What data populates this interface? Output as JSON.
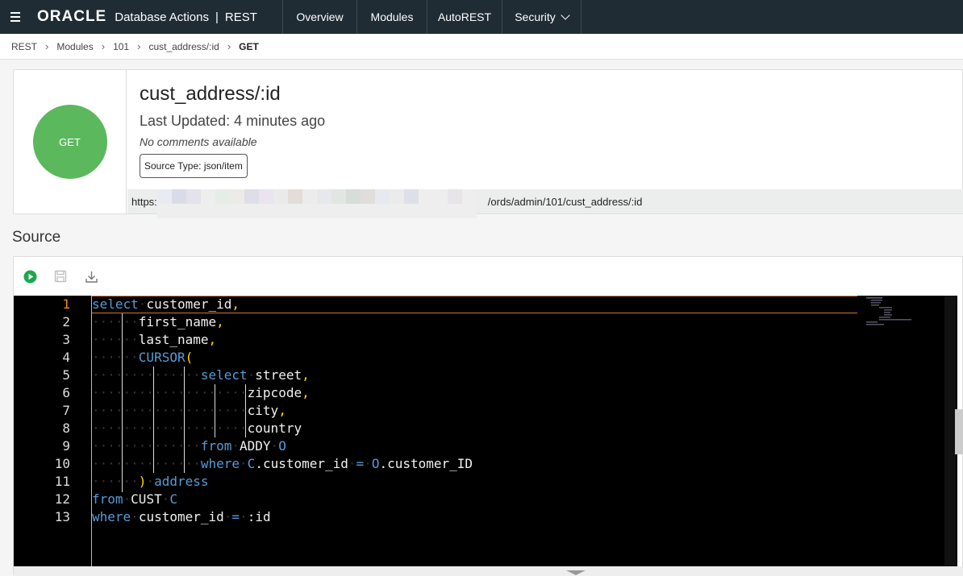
{
  "topbar": {
    "logo": "ORACLE",
    "product": "Database Actions",
    "separator": "|",
    "area": "REST",
    "nav": [
      {
        "label": "Overview"
      },
      {
        "label": "Modules"
      },
      {
        "label": "AutoREST"
      },
      {
        "label": "Security"
      }
    ]
  },
  "breadcrumb": [
    "REST",
    "Modules",
    "101",
    "cust_address/:id",
    "GET"
  ],
  "card": {
    "method": "GET",
    "method_color": "#5cb85c",
    "title": "cust_address/:id",
    "updated": "Last Updated: 4 minutes ago",
    "comments": "No comments available",
    "source_type": "Source Type: json/item",
    "url_prefix": "https:",
    "url_suffix": "/ords/admin/101/cust_address/:id"
  },
  "source": {
    "heading": "Source",
    "toolbar": {
      "run_icon": "play-circle-icon",
      "save_icon": "save-icon",
      "download_icon": "download-icon"
    },
    "active_line": 1,
    "lines": [
      {
        "num": "1",
        "tokens": [
          [
            "kw",
            "select"
          ],
          [
            "dots",
            "·"
          ],
          [
            "id",
            "customer_id"
          ],
          [
            "punc",
            ","
          ]
        ]
      },
      {
        "num": "2",
        "tokens": [
          [
            "dots",
            "······"
          ],
          [
            "id",
            "first_name"
          ],
          [
            "punc",
            ","
          ]
        ]
      },
      {
        "num": "3",
        "tokens": [
          [
            "dots",
            "······"
          ],
          [
            "id",
            "last_name"
          ],
          [
            "punc",
            ","
          ]
        ]
      },
      {
        "num": "4",
        "tokens": [
          [
            "dots",
            "······"
          ],
          [
            "kw",
            "CURSOR"
          ],
          [
            "punc",
            "("
          ]
        ]
      },
      {
        "num": "5",
        "tokens": [
          [
            "dots",
            "··············"
          ],
          [
            "kw",
            "select"
          ],
          [
            "dots",
            "·"
          ],
          [
            "id",
            "street"
          ],
          [
            "punc",
            ","
          ]
        ]
      },
      {
        "num": "6",
        "tokens": [
          [
            "dots",
            "····················"
          ],
          [
            "id",
            "zipcode"
          ],
          [
            "punc",
            ","
          ]
        ]
      },
      {
        "num": "7",
        "tokens": [
          [
            "dots",
            "····················"
          ],
          [
            "id",
            "city"
          ],
          [
            "punc",
            ","
          ]
        ]
      },
      {
        "num": "8",
        "tokens": [
          [
            "dots",
            "····················"
          ],
          [
            "id",
            "country"
          ]
        ]
      },
      {
        "num": "9",
        "tokens": [
          [
            "dots",
            "··············"
          ],
          [
            "kw",
            "from"
          ],
          [
            "dots",
            "·"
          ],
          [
            "id",
            "ADDY"
          ],
          [
            "dots",
            "·"
          ],
          [
            "kw",
            "O"
          ]
        ]
      },
      {
        "num": "10",
        "tokens": [
          [
            "dots",
            "··············"
          ],
          [
            "kw",
            "where"
          ],
          [
            "dots",
            "·"
          ],
          [
            "kw",
            "C"
          ],
          [
            "id",
            ".customer_id"
          ],
          [
            "dots",
            "·"
          ],
          [
            "kw",
            "="
          ],
          [
            "dots",
            "·"
          ],
          [
            "kw",
            "O"
          ],
          [
            "id",
            ".customer_ID"
          ]
        ]
      },
      {
        "num": "11",
        "tokens": [
          [
            "dots",
            "······"
          ],
          [
            "punc",
            ")"
          ],
          [
            "dots",
            "·"
          ],
          [
            "kw",
            "address"
          ]
        ]
      },
      {
        "num": "12",
        "tokens": [
          [
            "kw",
            "from"
          ],
          [
            "dots",
            "·"
          ],
          [
            "id",
            "CUST"
          ],
          [
            "dots",
            "·"
          ],
          [
            "kw",
            "C"
          ]
        ]
      },
      {
        "num": "13",
        "tokens": [
          [
            "kw",
            "where"
          ],
          [
            "dots",
            "·"
          ],
          [
            "id",
            "customer_id"
          ],
          [
            "dots",
            "·"
          ],
          [
            "kw",
            "="
          ],
          [
            "dots",
            "·"
          ],
          [
            "id",
            ":id"
          ]
        ]
      }
    ]
  }
}
